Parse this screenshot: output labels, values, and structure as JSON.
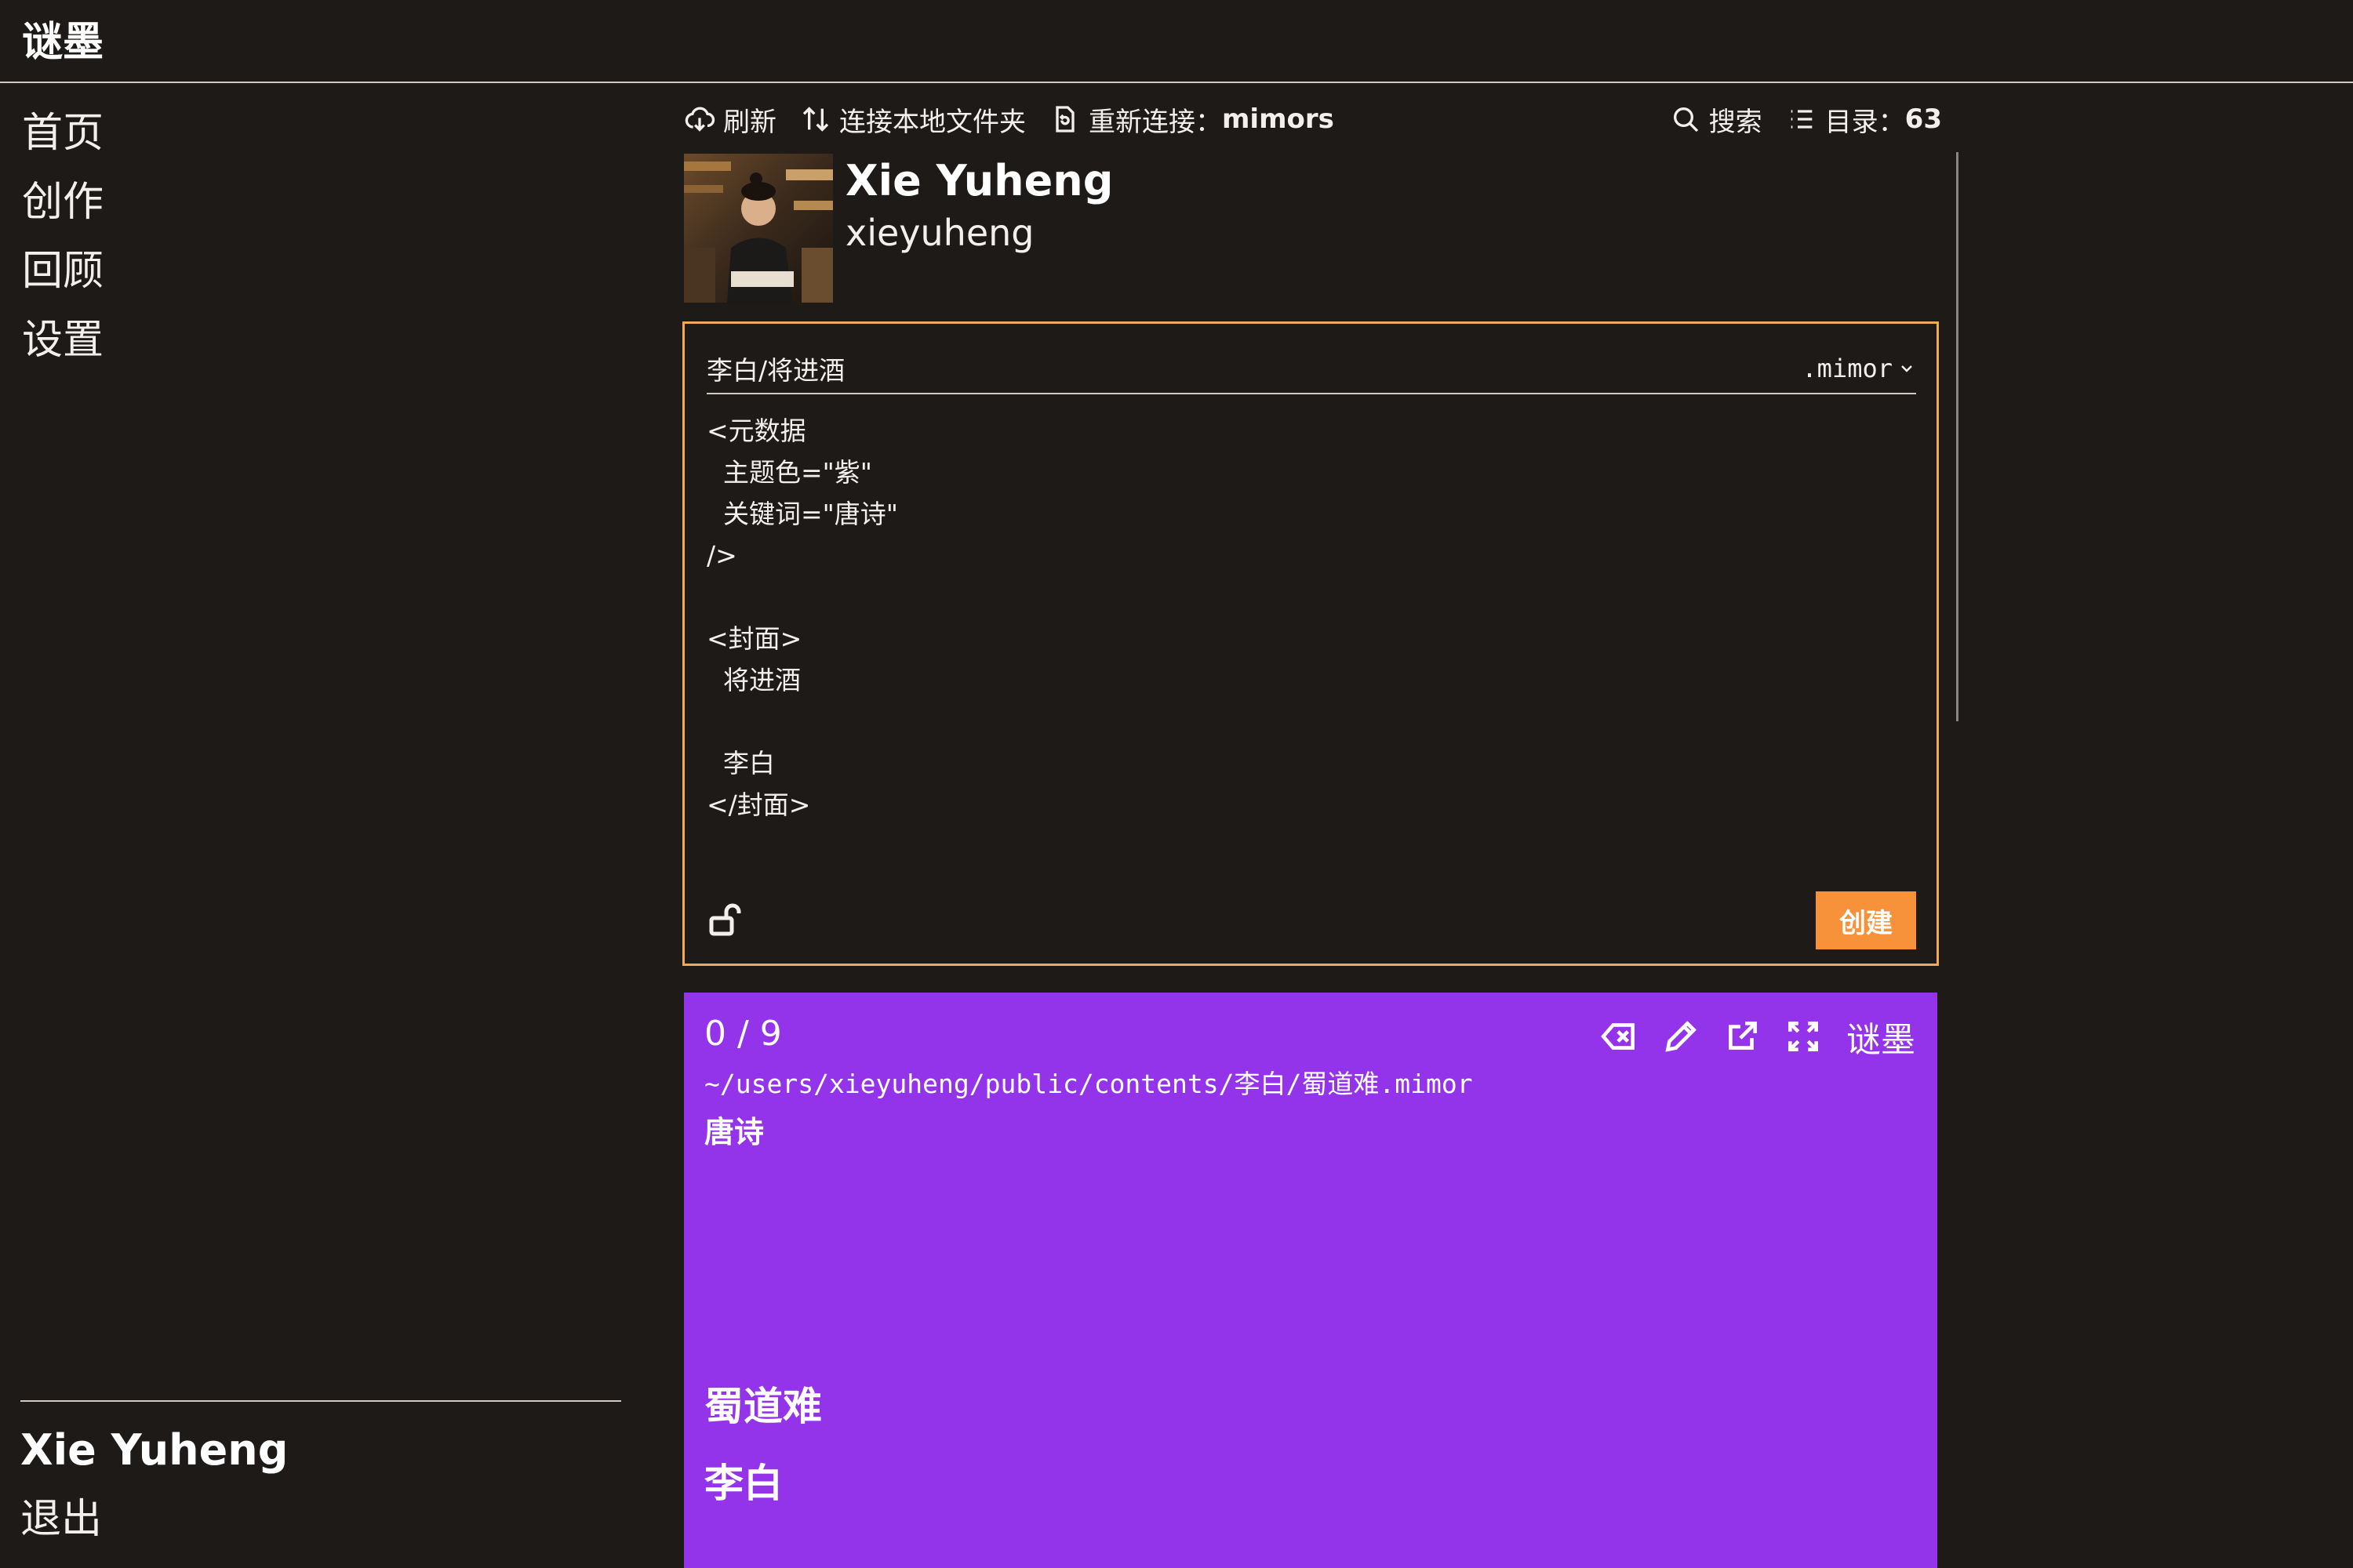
{
  "app": {
    "brand": "谜墨"
  },
  "sidebar": {
    "items": [
      {
        "label": "首页"
      },
      {
        "label": "创作"
      },
      {
        "label": "回顾"
      },
      {
        "label": "设置"
      }
    ],
    "user_name": "Xie Yuheng",
    "logout_label": "退出"
  },
  "toolbar": {
    "refresh_label": "刷新",
    "connect_local_label": "连接本地文件夹",
    "reconnect_label": "重新连接：",
    "reconnect_target": "mimors",
    "search_label": "搜索",
    "toc_label": "目录：",
    "toc_count": "63"
  },
  "profile": {
    "name": "Xie Yuheng",
    "handle": "xieyuheng"
  },
  "editor": {
    "path": "李白/将进酒",
    "extension": ".mimor",
    "content": "<元数据\n  主题色=\"紫\"\n  关键词=\"唐诗\"\n/>\n\n<封面>\n  将进酒\n\n  李白\n</封面>",
    "create_label": "创建"
  },
  "preview": {
    "count": "0 / 9",
    "brand": "谜墨",
    "path": "~/users/xieyuheng/public/contents/李白/蜀道难.mimor",
    "keyword": "唐诗",
    "title": "蜀道难",
    "author": "李白",
    "background_color": "#9333ea"
  },
  "colors": {
    "background": "#1e1a18",
    "accent": "#f7923a",
    "editor_border": "#f0a85a"
  }
}
